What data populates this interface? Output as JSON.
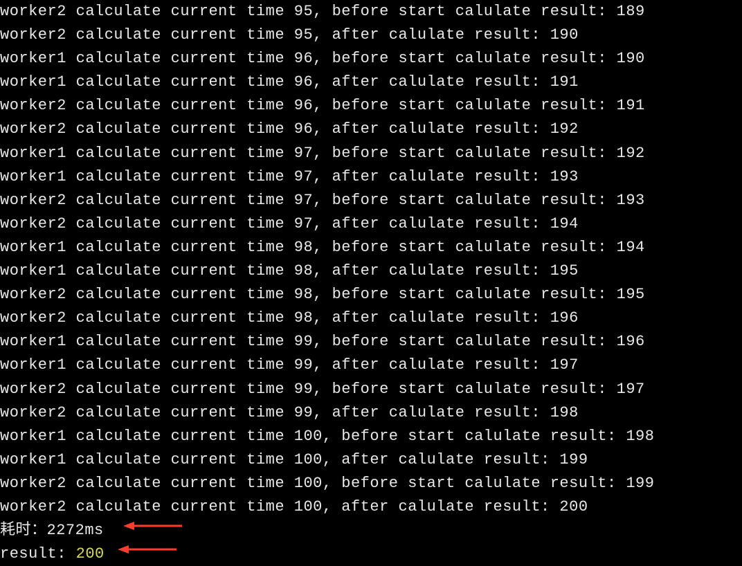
{
  "logs": [
    "worker2 calculate current time 95, before start calulate result: 189",
    "worker2 calculate current time 95, after calulate result: 190",
    "worker1 calculate current time 96, before start calulate result: 190",
    "worker1 calculate current time 96, after calulate result: 191",
    "worker2 calculate current time 96, before start calulate result: 191",
    "worker2 calculate current time 96, after calulate result: 192",
    "worker1 calculate current time 97, before start calulate result: 192",
    "worker1 calculate current time 97, after calulate result: 193",
    "worker2 calculate current time 97, before start calulate result: 193",
    "worker2 calculate current time 97, after calulate result: 194",
    "worker1 calculate current time 98, before start calulate result: 194",
    "worker1 calculate current time 98, after calulate result: 195",
    "worker2 calculate current time 98, before start calulate result: 195",
    "worker2 calculate current time 98, after calulate result: 196",
    "worker1 calculate current time 99, before start calulate result: 196",
    "worker1 calculate current time 99, after calulate result: 197",
    "worker2 calculate current time 99, before start calulate result: 197",
    "worker2 calculate current time 99, after calulate result: 198",
    "worker1 calculate current time 100, before start calulate result: 198",
    "worker1 calculate current time 100, after calulate result: 199",
    "worker2 calculate current time 100, before start calulate result: 199",
    "worker2 calculate current time 100, after calulate result: 200"
  ],
  "summary": {
    "elapsed_label": "耗时：",
    "elapsed_value": "2272ms",
    "result_label": "result: ",
    "result_value": "200"
  }
}
